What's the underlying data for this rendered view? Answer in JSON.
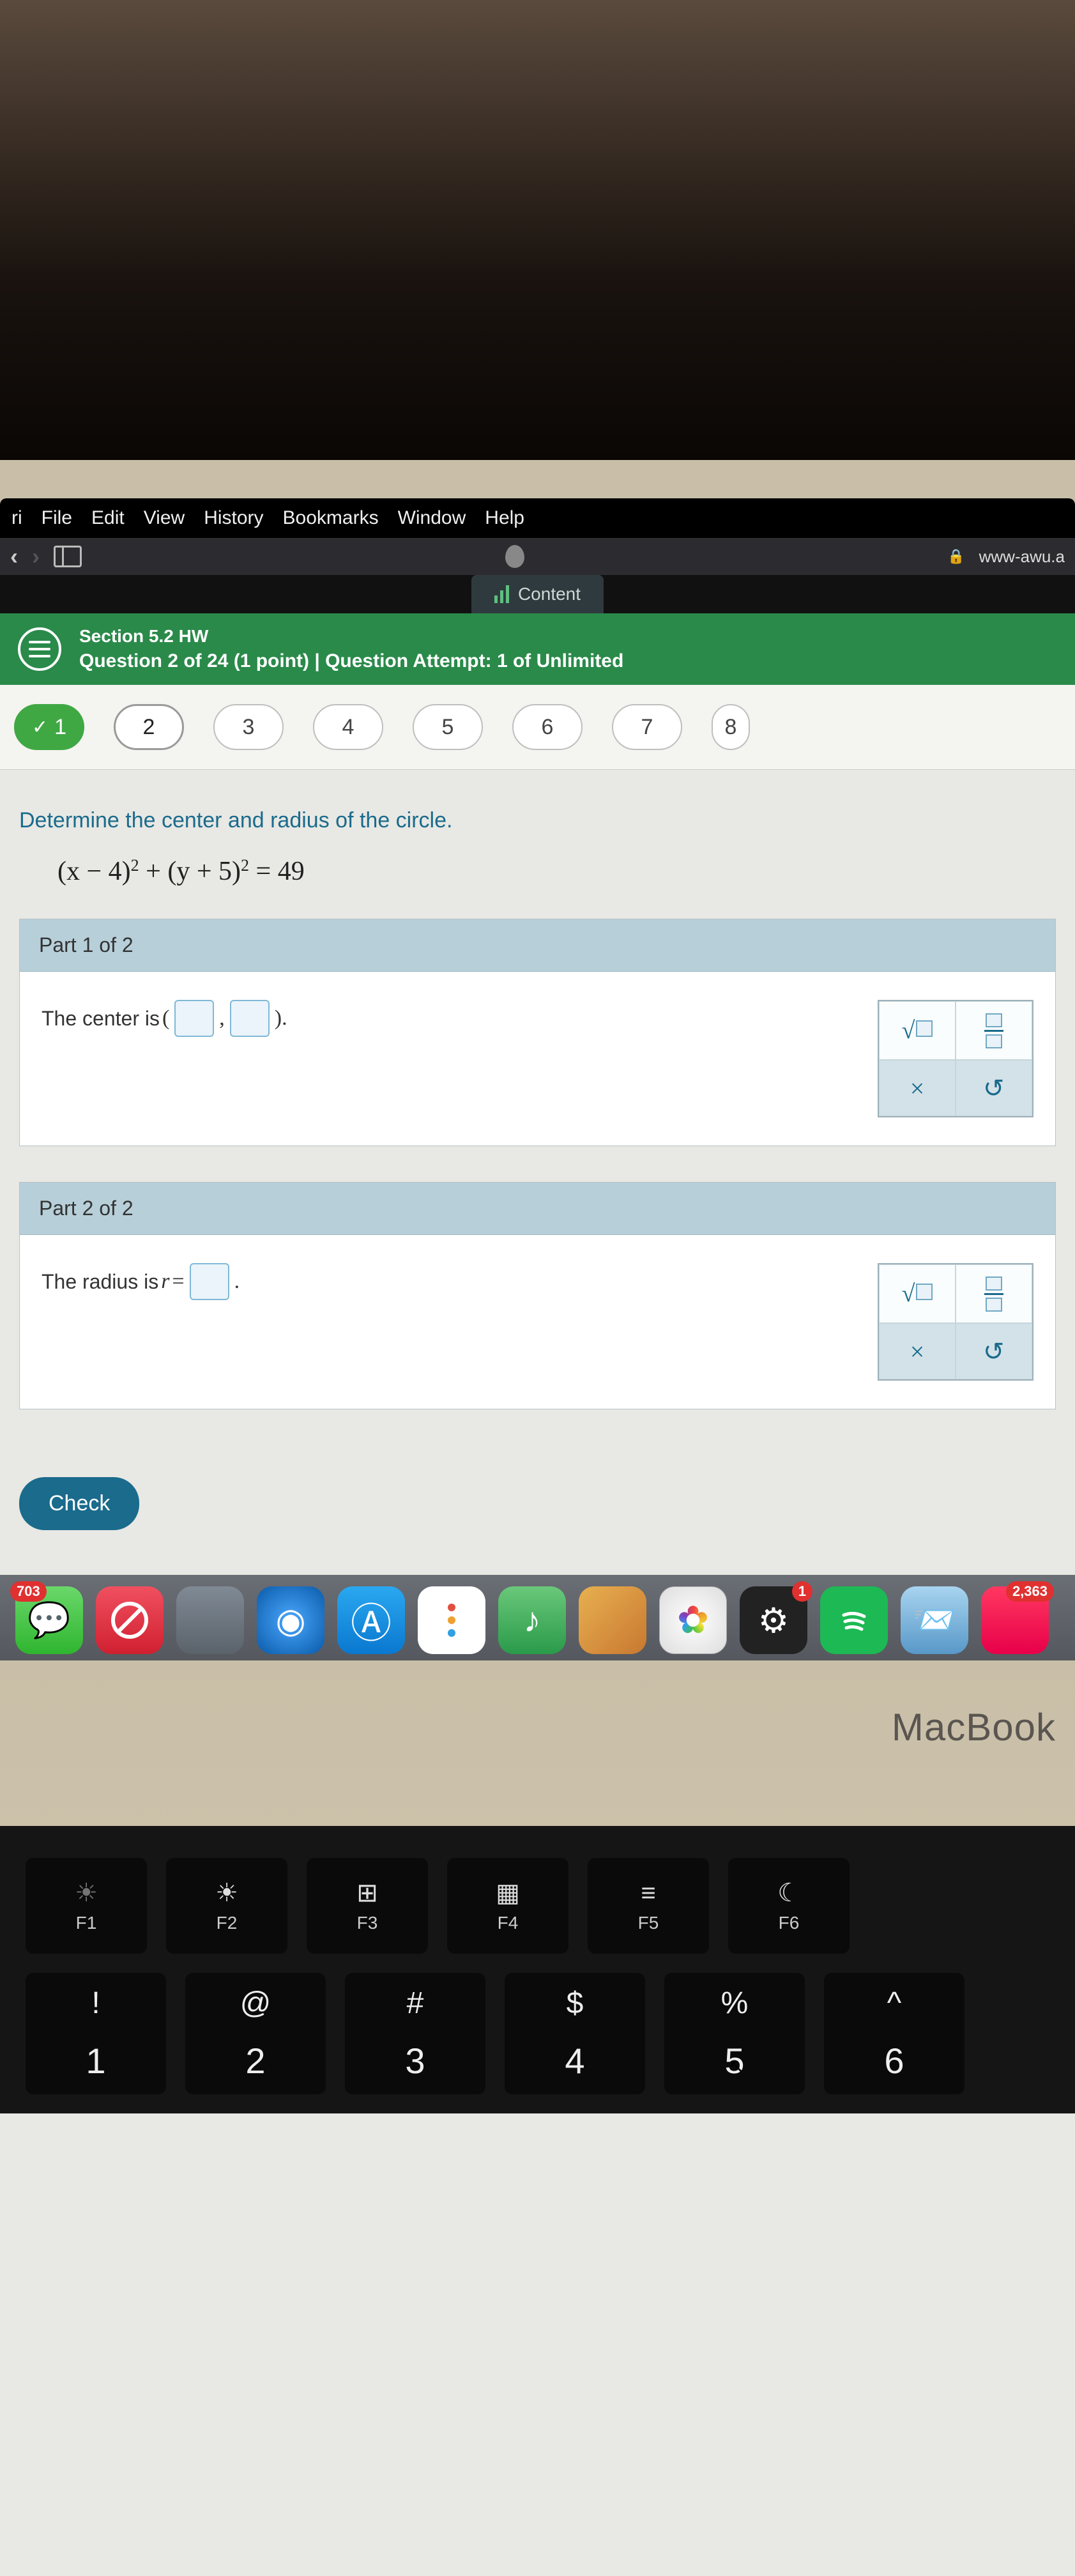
{
  "menubar": {
    "app": "ri",
    "items": [
      "File",
      "Edit",
      "View",
      "History",
      "Bookmarks",
      "Window",
      "Help"
    ]
  },
  "toolbar": {
    "url": "www-awu.a"
  },
  "tab": {
    "label": "Content"
  },
  "greenbar": {
    "section": "Section 5.2 HW",
    "status": "Question 2 of 24 (1 point)  |  Question Attempt: 1 of Unlimited"
  },
  "pills": {
    "done": "1",
    "current": "2",
    "rest": [
      "3",
      "4",
      "5",
      "6",
      "7",
      "8"
    ]
  },
  "prompt": "Determine the center and radius of the circle.",
  "equation": {
    "lhs_a": "(x − 4)",
    "lhs_b": " + (y + 5)",
    "rhs": " = 49",
    "exp": "2"
  },
  "part1": {
    "head": "Part 1 of 2",
    "text": "The center is ",
    "open": "(",
    "comma": ", ",
    "close": ")."
  },
  "part2": {
    "head": "Part 2 of 2",
    "text": "The radius is ",
    "var": "r",
    "eq": " = ",
    "period": "."
  },
  "tools": {
    "clear": "×",
    "undo": "↻"
  },
  "check": "Check",
  "dock": {
    "msg_badge": "703",
    "notif_badge": "1",
    "music_badge": "2,363"
  },
  "brand": "MacBook",
  "keys": {
    "frow": [
      {
        "icon": "☀",
        "sub": "dim",
        "lbl": "F1"
      },
      {
        "icon": "☀",
        "sub": "",
        "lbl": "F2"
      },
      {
        "icon": "⊞",
        "sub": "",
        "lbl": "F3"
      },
      {
        "icon": "▦",
        "sub": "",
        "lbl": "F4"
      },
      {
        "icon": "≡",
        "sub": "",
        "lbl": "F5"
      },
      {
        "icon": "☾",
        "sub": "",
        "lbl": "F6"
      }
    ],
    "nrow": [
      {
        "top": "!",
        "bot": "1"
      },
      {
        "top": "@",
        "bot": "2"
      },
      {
        "top": "#",
        "bot": "3"
      },
      {
        "top": "$",
        "bot": "4"
      },
      {
        "top": "%",
        "bot": "5"
      },
      {
        "top": "^",
        "bot": "6"
      }
    ]
  }
}
